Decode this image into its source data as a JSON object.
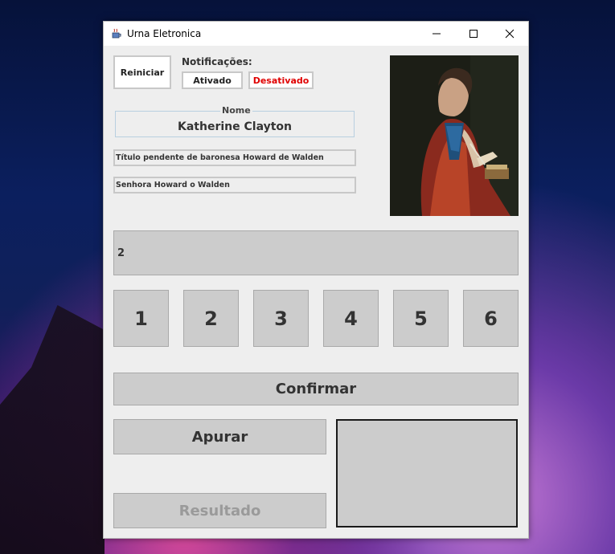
{
  "window": {
    "title": "Urna Eletronica",
    "icons": {
      "app": "java-cup-icon",
      "minimize": "minimize-icon",
      "maximize": "maximize-icon",
      "close": "close-icon"
    }
  },
  "controls": {
    "restart_label": "Reiniciar",
    "notifications_label": "Notificações:",
    "enabled_label": "Ativado",
    "disabled_label": "Desativado",
    "disabled_color": "#e00000"
  },
  "candidate": {
    "name_legend": "Nome",
    "name": "Katherine Clayton",
    "field1": "Título pendente de baronesa Howard de Walden",
    "field2": "Senhora Howard o Walden"
  },
  "display_value": "2",
  "keypad": [
    "1",
    "2",
    "3",
    "4",
    "5",
    "6"
  ],
  "actions": {
    "confirm_label": "Confirmar",
    "tally_label": "Apurar",
    "result_label": "Resultado"
  }
}
